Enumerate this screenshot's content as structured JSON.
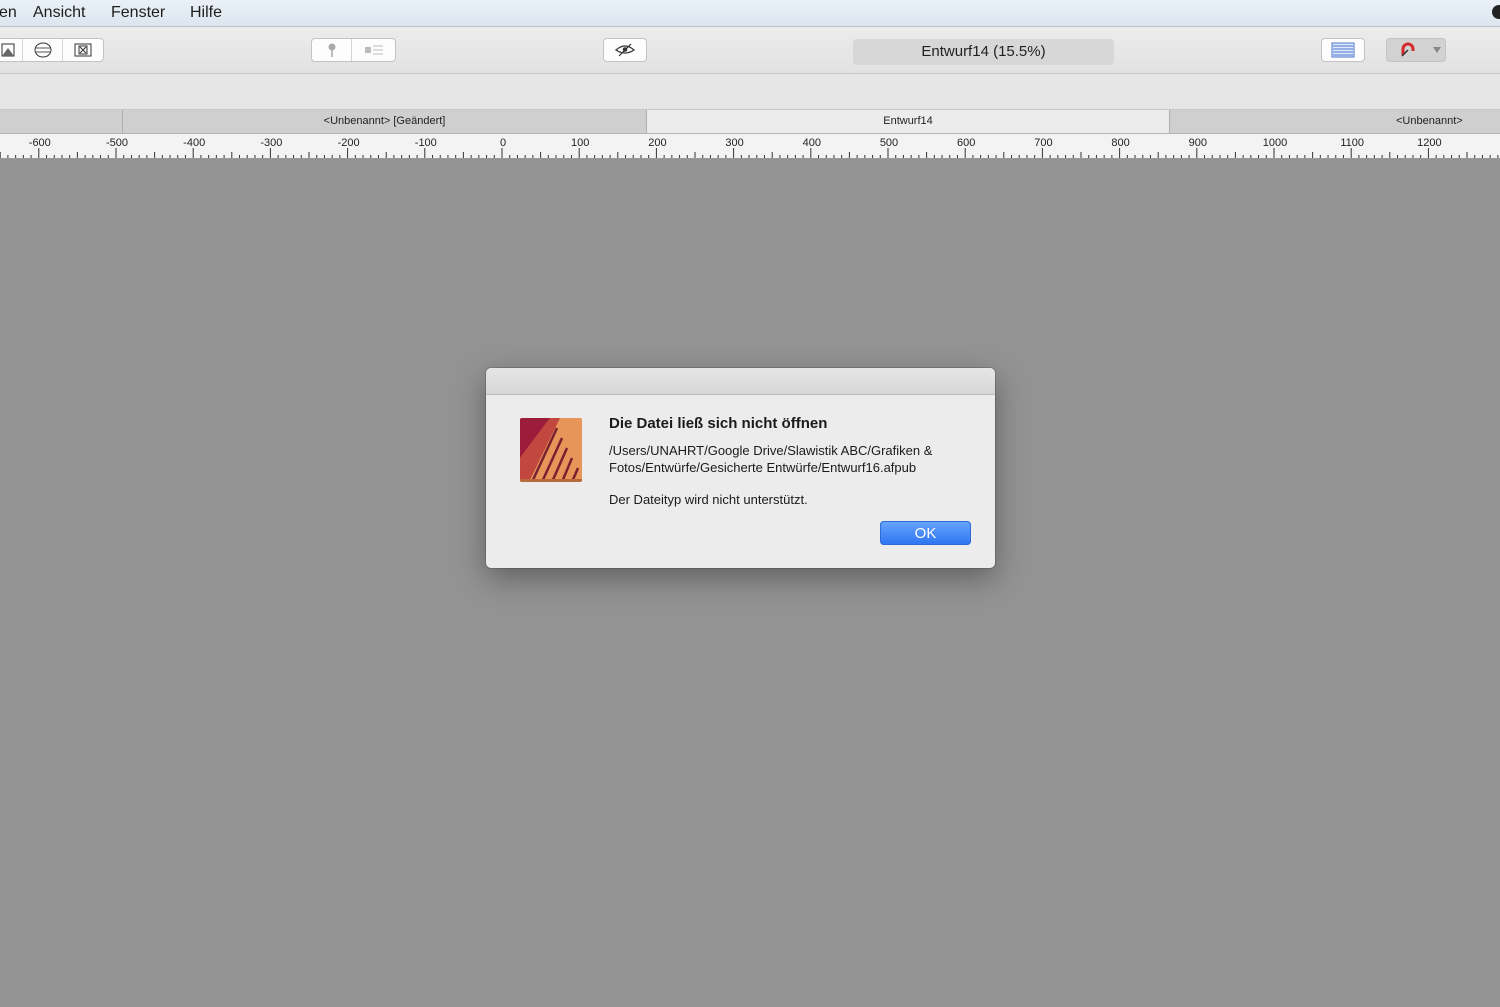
{
  "menubar": {
    "items": [
      "en",
      "Ansicht",
      "Fenster",
      "Hilfe"
    ]
  },
  "toolbar": {
    "document_title": "Entwurf14 (15.5%)"
  },
  "tabs": [
    {
      "label": "<Unbenannt> [Geändert]",
      "active": false
    },
    {
      "label": "Entwurf14",
      "active": true
    },
    {
      "label": "<Unbenannt>",
      "active": false
    }
  ],
  "ruler": {
    "labels": [
      "-600",
      "-500",
      "-400",
      "-300",
      "-200",
      "-100",
      "0",
      "100",
      "200",
      "300",
      "400",
      "500",
      "600",
      "700",
      "800",
      "900",
      "1000",
      "1100",
      "1200",
      "1"
    ]
  },
  "dialog": {
    "title": "Die Datei ließ sich nicht öffnen",
    "path": "/Users/UNAHRT/Google Drive/Slawistik ABC/Grafiken & Fotos/Entwürfe/Gesicherte  Entwürfe/Entwurf16.afpub",
    "reason": "Der Dateityp wird nicht unterstützt.",
    "ok_label": "OK"
  },
  "colors": {
    "canvas": "#939393",
    "ok_button": "#3b82f6",
    "icon_primary": "#e8955a",
    "icon_accent": "#9b1c3b"
  }
}
